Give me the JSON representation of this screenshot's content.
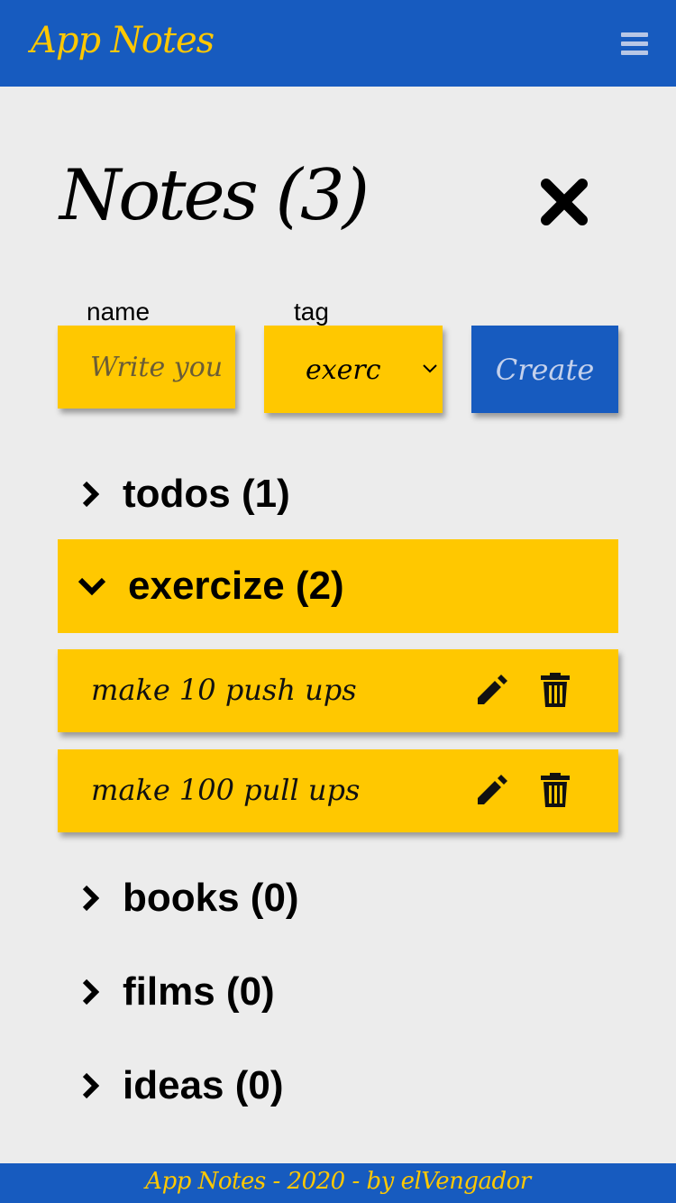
{
  "header": {
    "brand": "App Notes",
    "menu_icon": "hamburger-icon"
  },
  "page": {
    "title": "Notes (3)",
    "close_icon": "close-icon"
  },
  "form": {
    "name_label": "name",
    "name_placeholder": "Write your note",
    "tag_label": "tag",
    "tag_selected": "exercize",
    "create_label": "Create"
  },
  "groups": [
    {
      "label": "todos (1)",
      "expanded": false
    },
    {
      "label": "exercize (2)",
      "expanded": true,
      "notes": [
        {
          "text": "make 10 push ups"
        },
        {
          "text": "make 100 pull ups"
        }
      ]
    },
    {
      "label": "books (0)",
      "expanded": false
    },
    {
      "label": "films (0)",
      "expanded": false
    },
    {
      "label": "ideas (0)",
      "expanded": false
    }
  ],
  "colors": {
    "primary": "#175bbf",
    "accent": "#ffc800",
    "background": "#ececec"
  },
  "footer": {
    "text": "App Notes - 2020 - by elVengador"
  }
}
